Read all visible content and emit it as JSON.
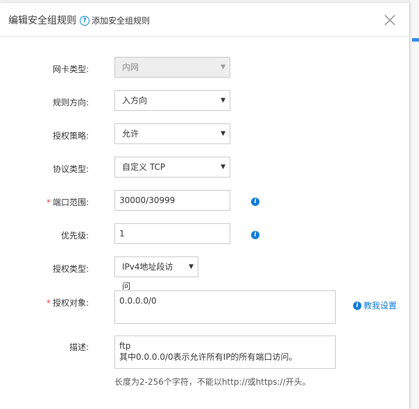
{
  "dialog": {
    "title": "编辑安全组规则",
    "help_link": "添加安全组规则"
  },
  "form": {
    "nic_type": {
      "label": "网卡类型:",
      "value": "内网"
    },
    "direction": {
      "label": "规则方向:",
      "value": "入方向"
    },
    "policy": {
      "label": "授权策略:",
      "value": "允许"
    },
    "protocol": {
      "label": "协议类型:",
      "value": "自定义 TCP"
    },
    "port_range": {
      "label": "端口范围:",
      "value": "30000/30999",
      "required": "*"
    },
    "priority": {
      "label": "优先级:",
      "value": "1"
    },
    "auth_type": {
      "label": "授权类型:",
      "value": "IPv4地址段访问"
    },
    "auth_object": {
      "label": "授权对象:",
      "value": "0.0.0.0/0",
      "required": "*",
      "help": "教我设置"
    },
    "description": {
      "label": "描述:",
      "line1": "ftp",
      "line2": "其中0.0.0.0/0表示允许所有IP的所有端口访问。",
      "hint": "长度为2-256个字符，不能以http://或https://开头。"
    }
  },
  "icons": {
    "close": "close-icon",
    "help": "question-circle-icon",
    "info": "info-circle-icon",
    "dropdown": "caret-down-icon"
  },
  "colors": {
    "accent": "#0f7ad9",
    "required": "#e4393c",
    "border": "#c8c8c8",
    "disabled_bg": "#eeeeee"
  }
}
